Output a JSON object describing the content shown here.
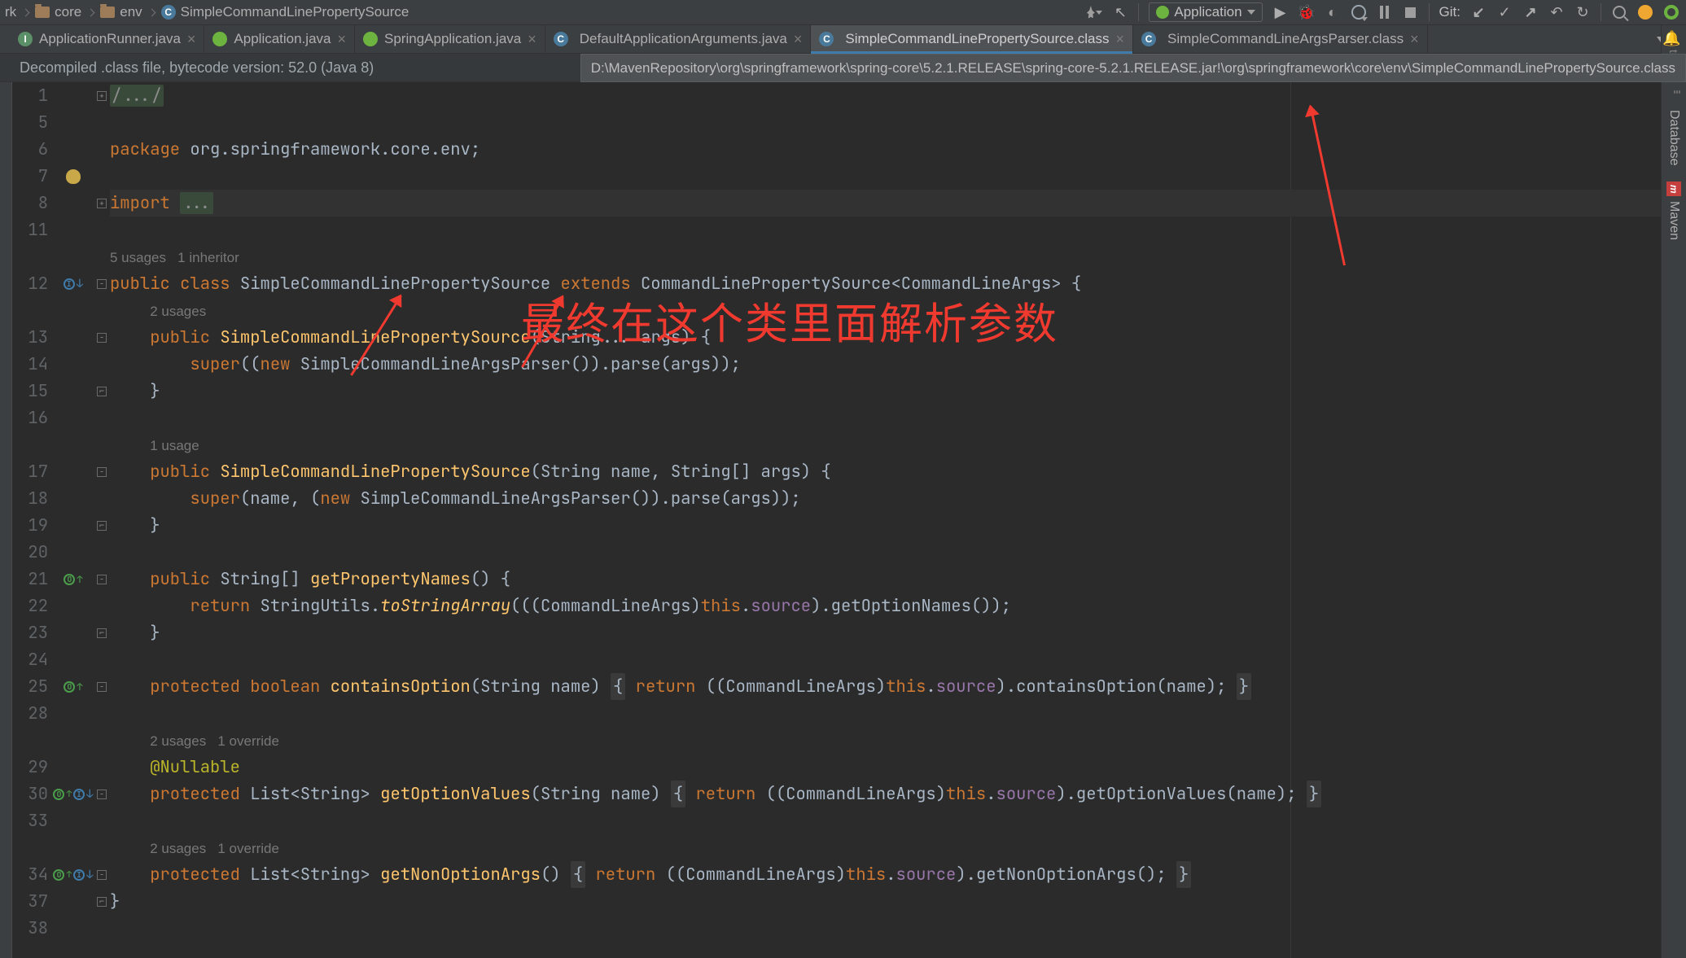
{
  "breadcrumbs": [
    "rk",
    "core",
    "env",
    "SimpleCommandLinePropertySource"
  ],
  "run_config": "Application",
  "git_label": "Git:",
  "strip": {
    "notifications": "tions",
    "database": "Database",
    "maven": "Maven"
  },
  "tabs": [
    {
      "icon": "interface",
      "label": "ApplicationRunner.java"
    },
    {
      "icon": "spring",
      "label": "Application.java"
    },
    {
      "icon": "spring",
      "label": "SpringApplication.java"
    },
    {
      "icon": "class",
      "label": "DefaultApplicationArguments.java"
    },
    {
      "icon": "class",
      "label": "SimpleCommandLinePropertySource.class",
      "active": true
    },
    {
      "icon": "class",
      "label": "SimpleCommandLineArgsParser.class"
    }
  ],
  "banner": "Decompiled .class file, bytecode version: 52.0 (Java 8)",
  "path_tip": "D:\\MavenRepository\\org\\springframework\\spring-core\\5.2.1.RELEASE\\spring-core-5.2.1.RELEASE.jar!\\org\\springframework\\core\\env\\SimpleCommandLinePropertySource.class",
  "annotation_text": "最终在这个类里面解析参数",
  "lines": {
    "l1": {
      "num": "1",
      "fold": "plus"
    },
    "l5": {
      "num": "5"
    },
    "l6": {
      "num": "6"
    },
    "l7": {
      "num": "7"
    },
    "l8": {
      "num": "8",
      "fold": "plus",
      "hl": true
    },
    "l11": {
      "num": "11"
    },
    "inlay_class": "5 usages   1 inheritor",
    "l12": {
      "num": "12",
      "fold": "minus"
    },
    "inlay_2u": "2 usages",
    "l13": {
      "num": "13",
      "fold": "minus"
    },
    "l14": {
      "num": "14"
    },
    "l15": {
      "num": "15",
      "fold": "end"
    },
    "l16": {
      "num": "16"
    },
    "inlay_1u": "1 usage",
    "l17": {
      "num": "17",
      "fold": "minus"
    },
    "l18": {
      "num": "18"
    },
    "l19": {
      "num": "19",
      "fold": "end"
    },
    "l20": {
      "num": "20"
    },
    "l21": {
      "num": "21",
      "fold": "minus"
    },
    "l22": {
      "num": "22"
    },
    "l23": {
      "num": "23",
      "fold": "end"
    },
    "l24": {
      "num": "24"
    },
    "l25": {
      "num": "25",
      "fold": "minus"
    },
    "l28": {
      "num": "28"
    },
    "inlay_2u1o": "2 usages   1 override",
    "l29": {
      "num": "29"
    },
    "l30": {
      "num": "30",
      "fold": "minus"
    },
    "l33": {
      "num": "33"
    },
    "l34": {
      "num": "34",
      "fold": "minus"
    },
    "l37": {
      "num": "37",
      "fold": "end"
    },
    "l38": {
      "num": "38"
    }
  },
  "tokens": {
    "package": "package",
    "import": "import",
    "public": "public",
    "class": "class",
    "extends": "extends",
    "new": "new",
    "super": "super",
    "return": "return",
    "protected": "protected",
    "boolean": "boolean",
    "this": "this",
    "nullable": "@Nullable",
    "pkg_name": "org.springframework.core.env",
    "ellipsis": "...",
    "folded_comment": "/.../",
    "SimpleCommandLinePropertySource": "SimpleCommandLinePropertySource",
    "CommandLinePropertySource": "CommandLinePropertySource",
    "CommandLineArgs": "CommandLineArgs",
    "SimpleCommandLineArgsParser": "SimpleCommandLineArgsParser",
    "String": "String",
    "List": "List",
    "StringUtils": "StringUtils",
    "args": "args",
    "name": "name",
    "source": "source",
    "parse": "parse",
    "getPropertyNames": "getPropertyNames",
    "toStringArray": "toStringArray",
    "getOptionNames": "getOptionNames",
    "containsOption": "containsOption",
    "getOptionValues": "getOptionValues",
    "getNonOptionArgs": "getNonOptionArgs"
  }
}
